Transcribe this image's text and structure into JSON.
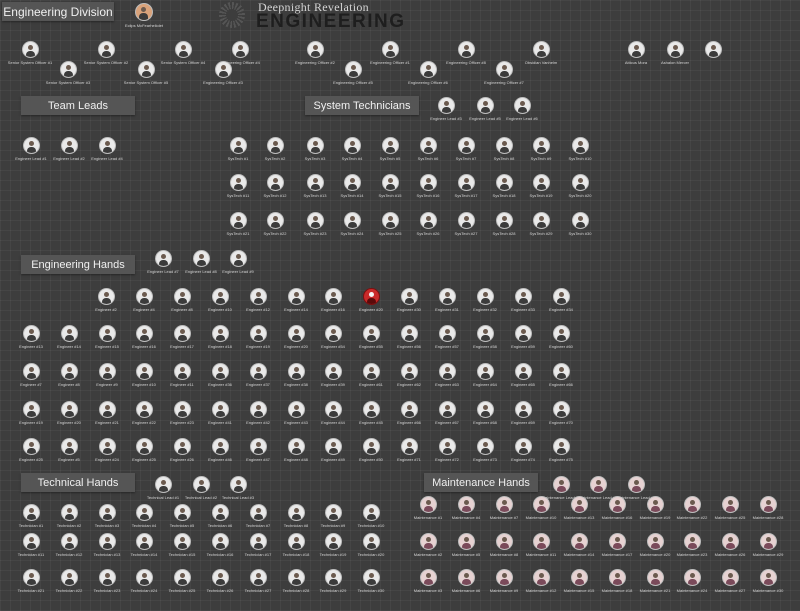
{
  "title": "Engineering Division",
  "leader": {
    "label": "Eclips McFearheliolet"
  },
  "logo": {
    "line1": "Deepnight Revelation",
    "line2": "ENGINEERING"
  },
  "sections": {
    "team_leads": "Team Leads",
    "system_technicians": "System Technicians",
    "engineering_hands": "Engineering Hands",
    "technical_hands": "Technical Hands",
    "maintenance_hands": "Maintenance Hands"
  },
  "command_row1": [
    "Senior System Officer #1",
    "Senior System Officer #2",
    "Senior System Officer #4",
    "Engineering Officer #4",
    "Engineering Officer #2",
    "Engineering Officer #1",
    "Engineering Officer #8",
    "Obsidian Vanhelm",
    "Atticus Mora",
    "Ashalon Mercer"
  ],
  "command_row2": [
    "Senior System Officer #3",
    "Senior System Officer #5",
    "Engineering Officer #3",
    "Engineering Officer #5",
    "Engineering Officer #6",
    "Engineering Officer #7"
  ],
  "tech_leads": [
    "Engineer Lead #3",
    "Engineer Lead #5",
    "Engineer Lead #6"
  ],
  "team_leads": [
    "Engineer Lead #1",
    "Engineer Lead #2",
    "Engineer Lead #4"
  ],
  "systech_rows": [
    [
      "SysTech #1",
      "SysTech #2",
      "SysTech #3",
      "SysTech #4",
      "SysTech #5",
      "SysTech #6",
      "SysTech #7",
      "SysTech #8",
      "SysTech #9",
      "SysTech #10"
    ],
    [
      "SysTech #11",
      "SysTech #12",
      "SysTech #13",
      "SysTech #14",
      "SysTech #15",
      "SysTech #16",
      "SysTech #17",
      "SysTech #18",
      "SysTech #19",
      "SysTech #20"
    ],
    [
      "SysTech #21",
      "SysTech #22",
      "SysTech #23",
      "SysTech #24",
      "SysTech #25",
      "SysTech #26",
      "SysTech #27",
      "SysTech #28",
      "SysTech #29",
      "SysTech #30"
    ]
  ],
  "eng_leads": [
    "Engineer Lead #7",
    "Engineer Lead #8",
    "Engineer Lead #9"
  ],
  "eng_rows": [
    [
      "Engineer #2",
      "Engineer #4",
      "Engineer #8",
      "Engineer #10",
      "Engineer #12",
      "Engineer #14",
      "Engineer #16",
      "Engineer #20",
      "Engineer #30",
      "Engineer #31",
      "Engineer #32",
      "Engineer #33",
      "Engineer #34",
      "Engineer #35"
    ],
    [
      "Engineer #13",
      "Engineer #14",
      "Engineer #15",
      "Engineer #16",
      "Engineer #17",
      "Engineer #18",
      "Engineer #19",
      "Engineer #20",
      "Engineer #54",
      "Engineer #55",
      "Engineer #56",
      "Engineer #57",
      "Engineer #58",
      "Engineer #59",
      "Engineer #60"
    ],
    [
      "Engineer #7",
      "Engineer #8",
      "Engineer #9",
      "Engineer #10",
      "Engineer #11",
      "Engineer #36",
      "Engineer #37",
      "Engineer #38",
      "Engineer #39",
      "Engineer #61",
      "Engineer #62",
      "Engineer #63",
      "Engineer #64",
      "Engineer #65",
      "Engineer #66"
    ],
    [
      "Engineer #19",
      "Engineer #20",
      "Engineer #21",
      "Engineer #22",
      "Engineer #23",
      "Engineer #41",
      "Engineer #42",
      "Engineer #43",
      "Engineer #44",
      "Engineer #45",
      "Engineer #66",
      "Engineer #67",
      "Engineer #68",
      "Engineer #69",
      "Engineer #70"
    ],
    [
      "Engineer #25",
      "Engineer #5",
      "Engineer #24",
      "Engineer #25",
      "Engineer #26",
      "Engineer #46",
      "Engineer #47",
      "Engineer #48",
      "Engineer #49",
      "Engineer #50",
      "Engineer #71",
      "Engineer #72",
      "Engineer #73",
      "Engineer #74",
      "Engineer #75"
    ]
  ],
  "technical_leads": [
    "Technical Lead #1",
    "Technical Lead #2",
    "Technical Lead #3"
  ],
  "maintenance_leads": [
    "Maintenance Lead #1",
    "Maintenance Lead #2",
    "Maintenance Lead #3"
  ],
  "technical_rows": [
    [
      "Technician #1",
      "Technician #2",
      "Technician #3",
      "Technician #4",
      "Technician #5",
      "Technician #6",
      "Technician #7",
      "Technician #8",
      "Technician #9",
      "Technician #10"
    ],
    [
      "Technician #11",
      "Technician #12",
      "Technician #13",
      "Technician #14",
      "Technician #15",
      "Technician #16",
      "Technician #17",
      "Technician #18",
      "Technician #19",
      "Technician #20"
    ],
    [
      "Technician #21",
      "Technician #22",
      "Technician #23",
      "Technician #24",
      "Technician #25",
      "Technician #26",
      "Technician #27",
      "Technician #28",
      "Technician #29",
      "Technician #30"
    ]
  ],
  "maintenance_rows": [
    [
      "Maintenance #1",
      "Maintenance #4",
      "Maintenance #7",
      "Maintenance #10",
      "Maintenance #13",
      "Maintenance #16",
      "Maintenance #19",
      "Maintenance #22",
      "Maintenance #25",
      "Maintenance #28"
    ],
    [
      "Maintenance #2",
      "Maintenance #5",
      "Maintenance #8",
      "Maintenance #11",
      "Maintenance #14",
      "Maintenance #17",
      "Maintenance #20",
      "Maintenance #23",
      "Maintenance #26",
      "Maintenance #29"
    ],
    [
      "Maintenance #3",
      "Maintenance #6",
      "Maintenance #9",
      "Maintenance #12",
      "Maintenance #15",
      "Maintenance #18",
      "Maintenance #21",
      "Maintenance #24",
      "Maintenance #27",
      "Maintenance #30"
    ]
  ],
  "icons": {
    "avatar": "person-avatar-icon",
    "logo": "gear-logo-icon"
  },
  "colors": {
    "background": "#3d3d3d",
    "section": "#555555",
    "highlight": "#c92a2a"
  }
}
